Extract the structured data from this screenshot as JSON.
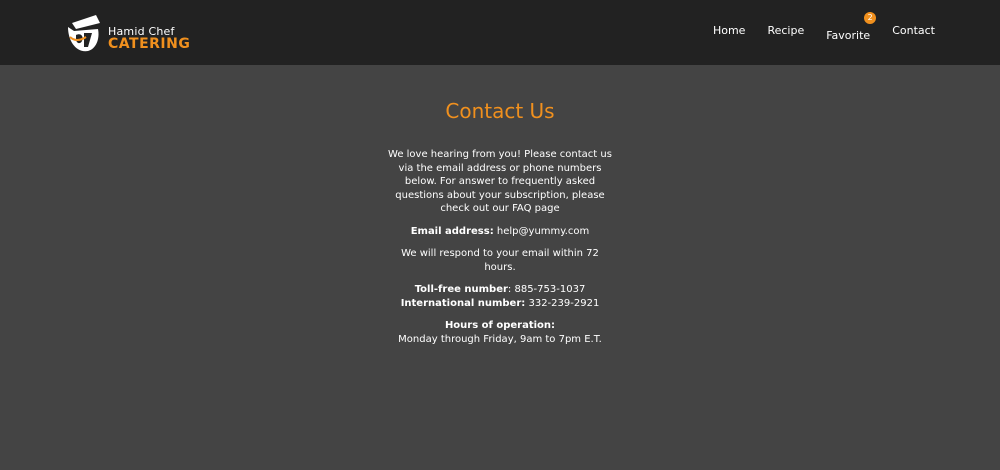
{
  "header": {
    "brand_top": "Hamid Chef",
    "brand_main": "CATERING",
    "nav": [
      {
        "label": "Home"
      },
      {
        "label": "Recipe"
      },
      {
        "label": "Favorite",
        "badge": "2"
      },
      {
        "label": "Contact"
      }
    ]
  },
  "contact": {
    "title": "Contact Us",
    "intro": "We love hearing from you! Please contact us via the email address or phone numbers below. For answer to frequently asked questions about your subscription, please check out our FAQ page",
    "email_label": "Email address:",
    "email_value": "help@yummy.com",
    "response_note": "We will respond to your email within 72 hours.",
    "tollfree_label": "Toll-free number",
    "tollfree_value": ": 885-753-1037",
    "intl_label": "International number:",
    "intl_value": "332-239-2921",
    "hours_label": "Hours of operation:",
    "hours_value": "Monday through Friday, 9am to 7pm E.T."
  },
  "colors": {
    "accent": "#f0901e",
    "header_bg": "#222222",
    "page_bg": "#444444"
  }
}
